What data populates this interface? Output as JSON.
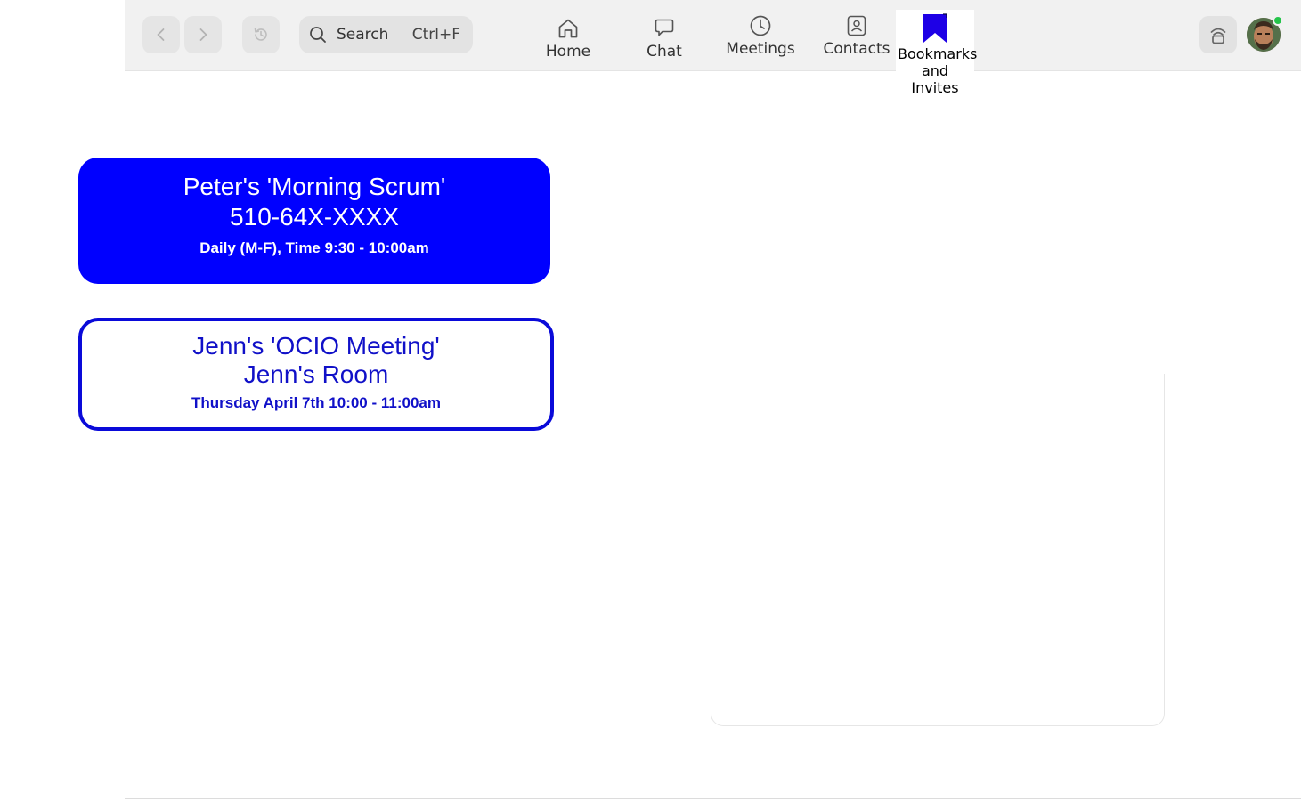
{
  "search": {
    "label": "Search",
    "shortcut": "Ctrl+F"
  },
  "tabs": {
    "home": "Home",
    "chat": "Chat",
    "meetings": "Meetings",
    "contacts": "Contacts",
    "bookmarks_line1": "Bookmarks",
    "bookmarks_line2": "and",
    "bookmarks_line3": "Invites"
  },
  "cards": [
    {
      "title": "Peter's 'Morning Scrum'",
      "subtitle": "510-64X-XXXX",
      "schedule": "Daily (M-F), Time 9:30 - 10:00am"
    },
    {
      "title": "Jenn's 'OCIO Meeting'",
      "subtitle": "Jenn's Room",
      "schedule": "Thursday April 7th 10:00 - 11:00am"
    }
  ],
  "colors": {
    "accent": "#0000ff",
    "card_outline": "#0a0ad9",
    "presence": "#24c44a",
    "topbar": "#f1f1f1"
  }
}
